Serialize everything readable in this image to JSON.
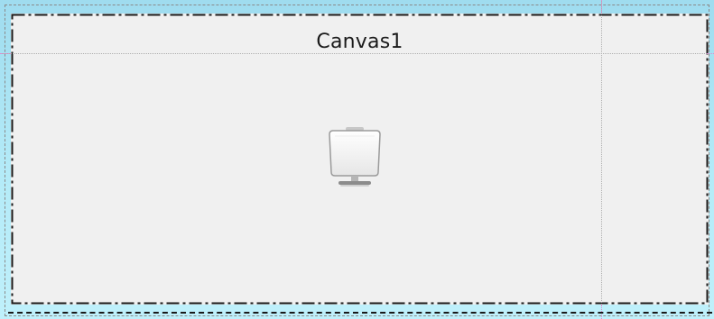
{
  "canvas": {
    "title": "Canvas1",
    "icon": "monitor-icon"
  },
  "colors": {
    "background": "#a9e3f4",
    "canvas_fill": "#f0f0f0",
    "border": "#1a1a1a",
    "guide": "#b0b0b0",
    "guide_accent": "#e08ad0"
  }
}
